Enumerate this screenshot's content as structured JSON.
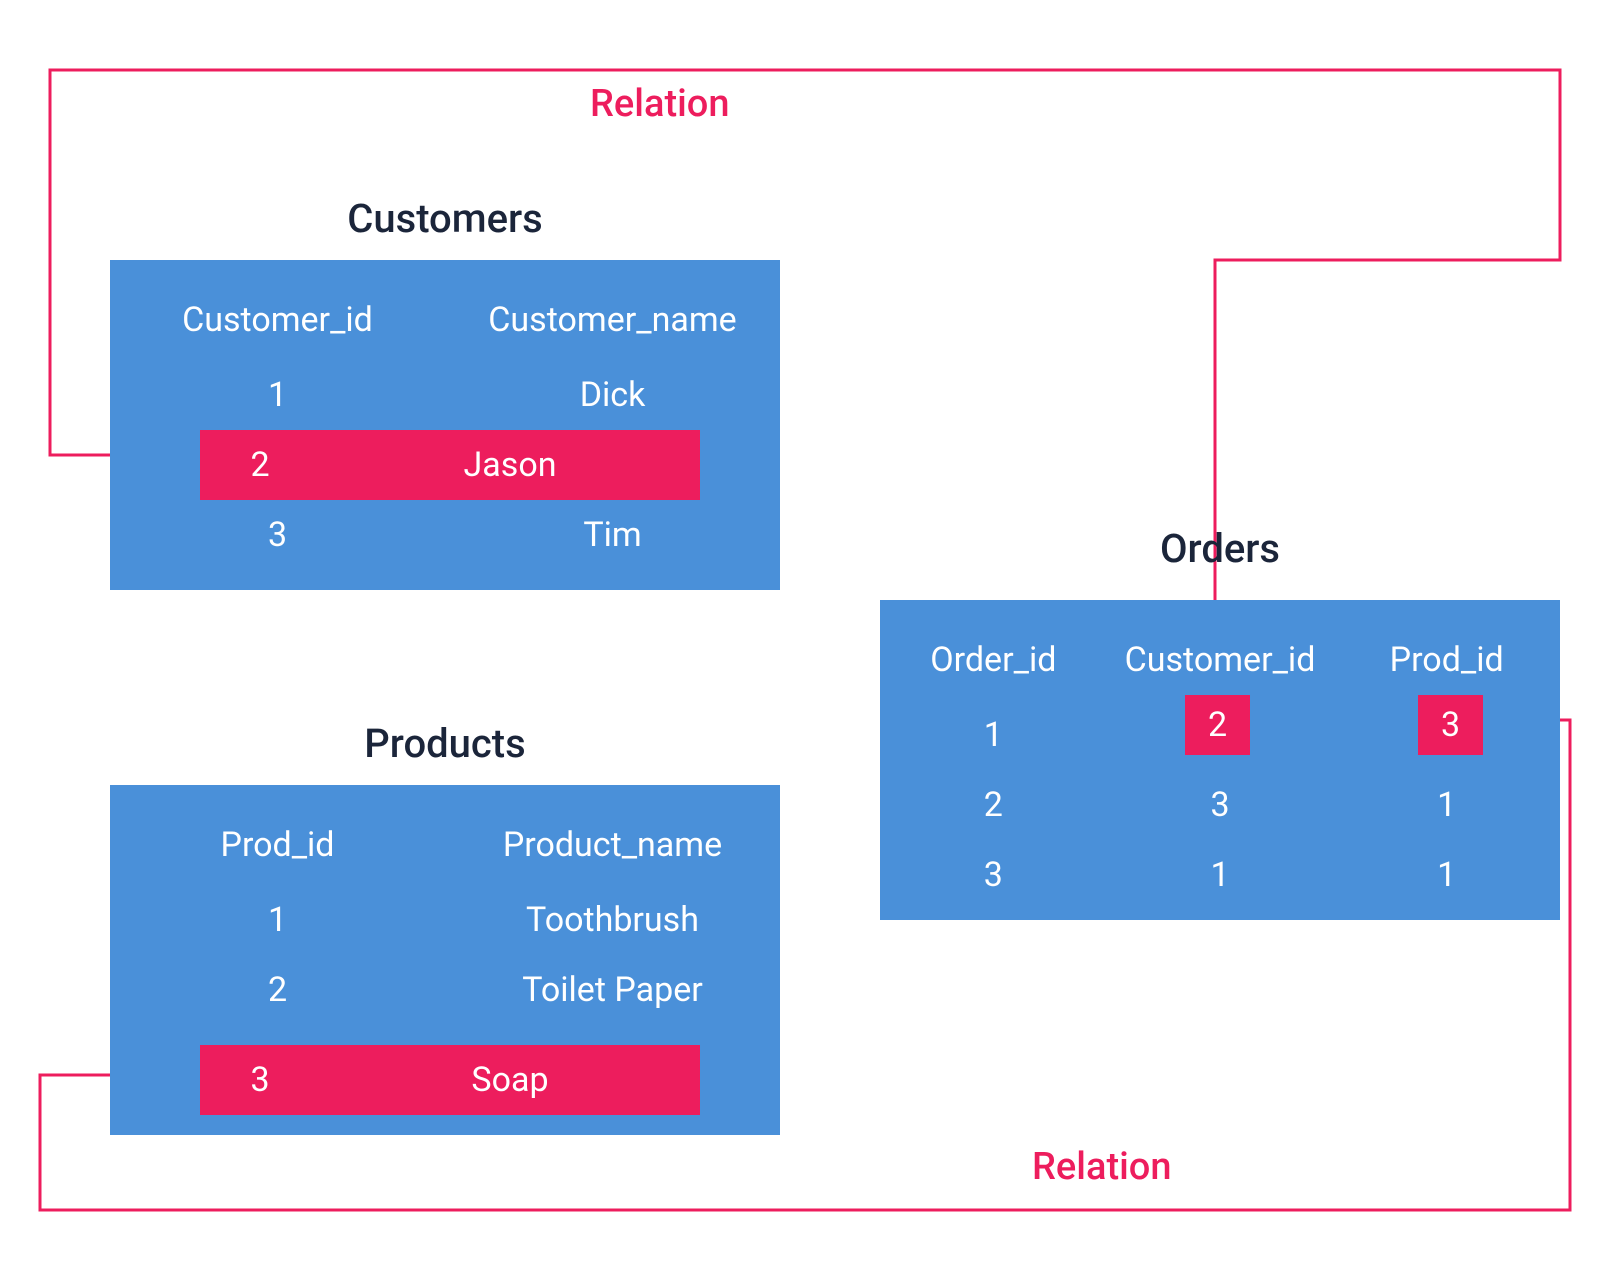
{
  "labels": {
    "relation_top": "Relation",
    "relation_bottom": "Relation"
  },
  "customers": {
    "title": "Customers",
    "h1": "Customer_id",
    "h2": "Customer_name",
    "r1c1": "1",
    "r1c2": "Dick",
    "r2c1": "2",
    "r2c2": "Jason",
    "r3c1": "3",
    "r3c2": "Tim"
  },
  "products": {
    "title": "Products",
    "h1": "Prod_id",
    "h2": "Product_name",
    "r1c1": "1",
    "r1c2": "Toothbrush",
    "r2c1": "2",
    "r2c2": "Toilet Paper",
    "r3c1": "3",
    "r3c2": "Soap"
  },
  "orders": {
    "title": "Orders",
    "h1": "Order_id",
    "h2": "Customer_id",
    "h3": "Prod_id",
    "r1c1": "1",
    "r1c2": "2",
    "r1c3": "3",
    "r2c1": "2",
    "r2c2": "3",
    "r2c3": "1",
    "r3c1": "3",
    "r3c2": "1",
    "r3c3": "1"
  },
  "colors": {
    "accent": "#ed1d5d",
    "table": "#4a90d9",
    "title": "#1b253a"
  }
}
